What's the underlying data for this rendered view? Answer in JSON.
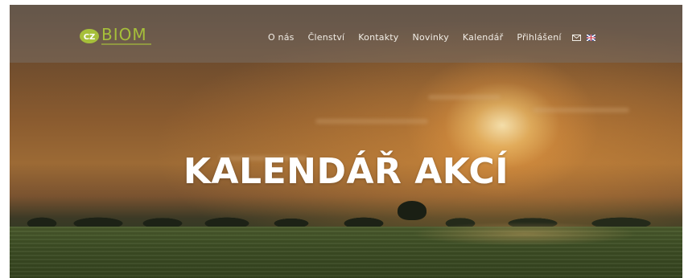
{
  "brand": {
    "logo_badge": "CZ",
    "logo_word": "BIOM",
    "colors": {
      "green": "#a6bf3a",
      "badge_bg": "#a6bf3a"
    }
  },
  "nav": {
    "items": [
      {
        "label": "O nás"
      },
      {
        "label": "Členství"
      },
      {
        "label": "Kontakty"
      },
      {
        "label": "Novinky"
      },
      {
        "label": "Kalendář"
      },
      {
        "label": "Přihlášení"
      }
    ],
    "icons": [
      "envelope-icon",
      "uk-flag-icon"
    ]
  },
  "hero": {
    "title": "KALENDÁŘ AKCÍ"
  }
}
